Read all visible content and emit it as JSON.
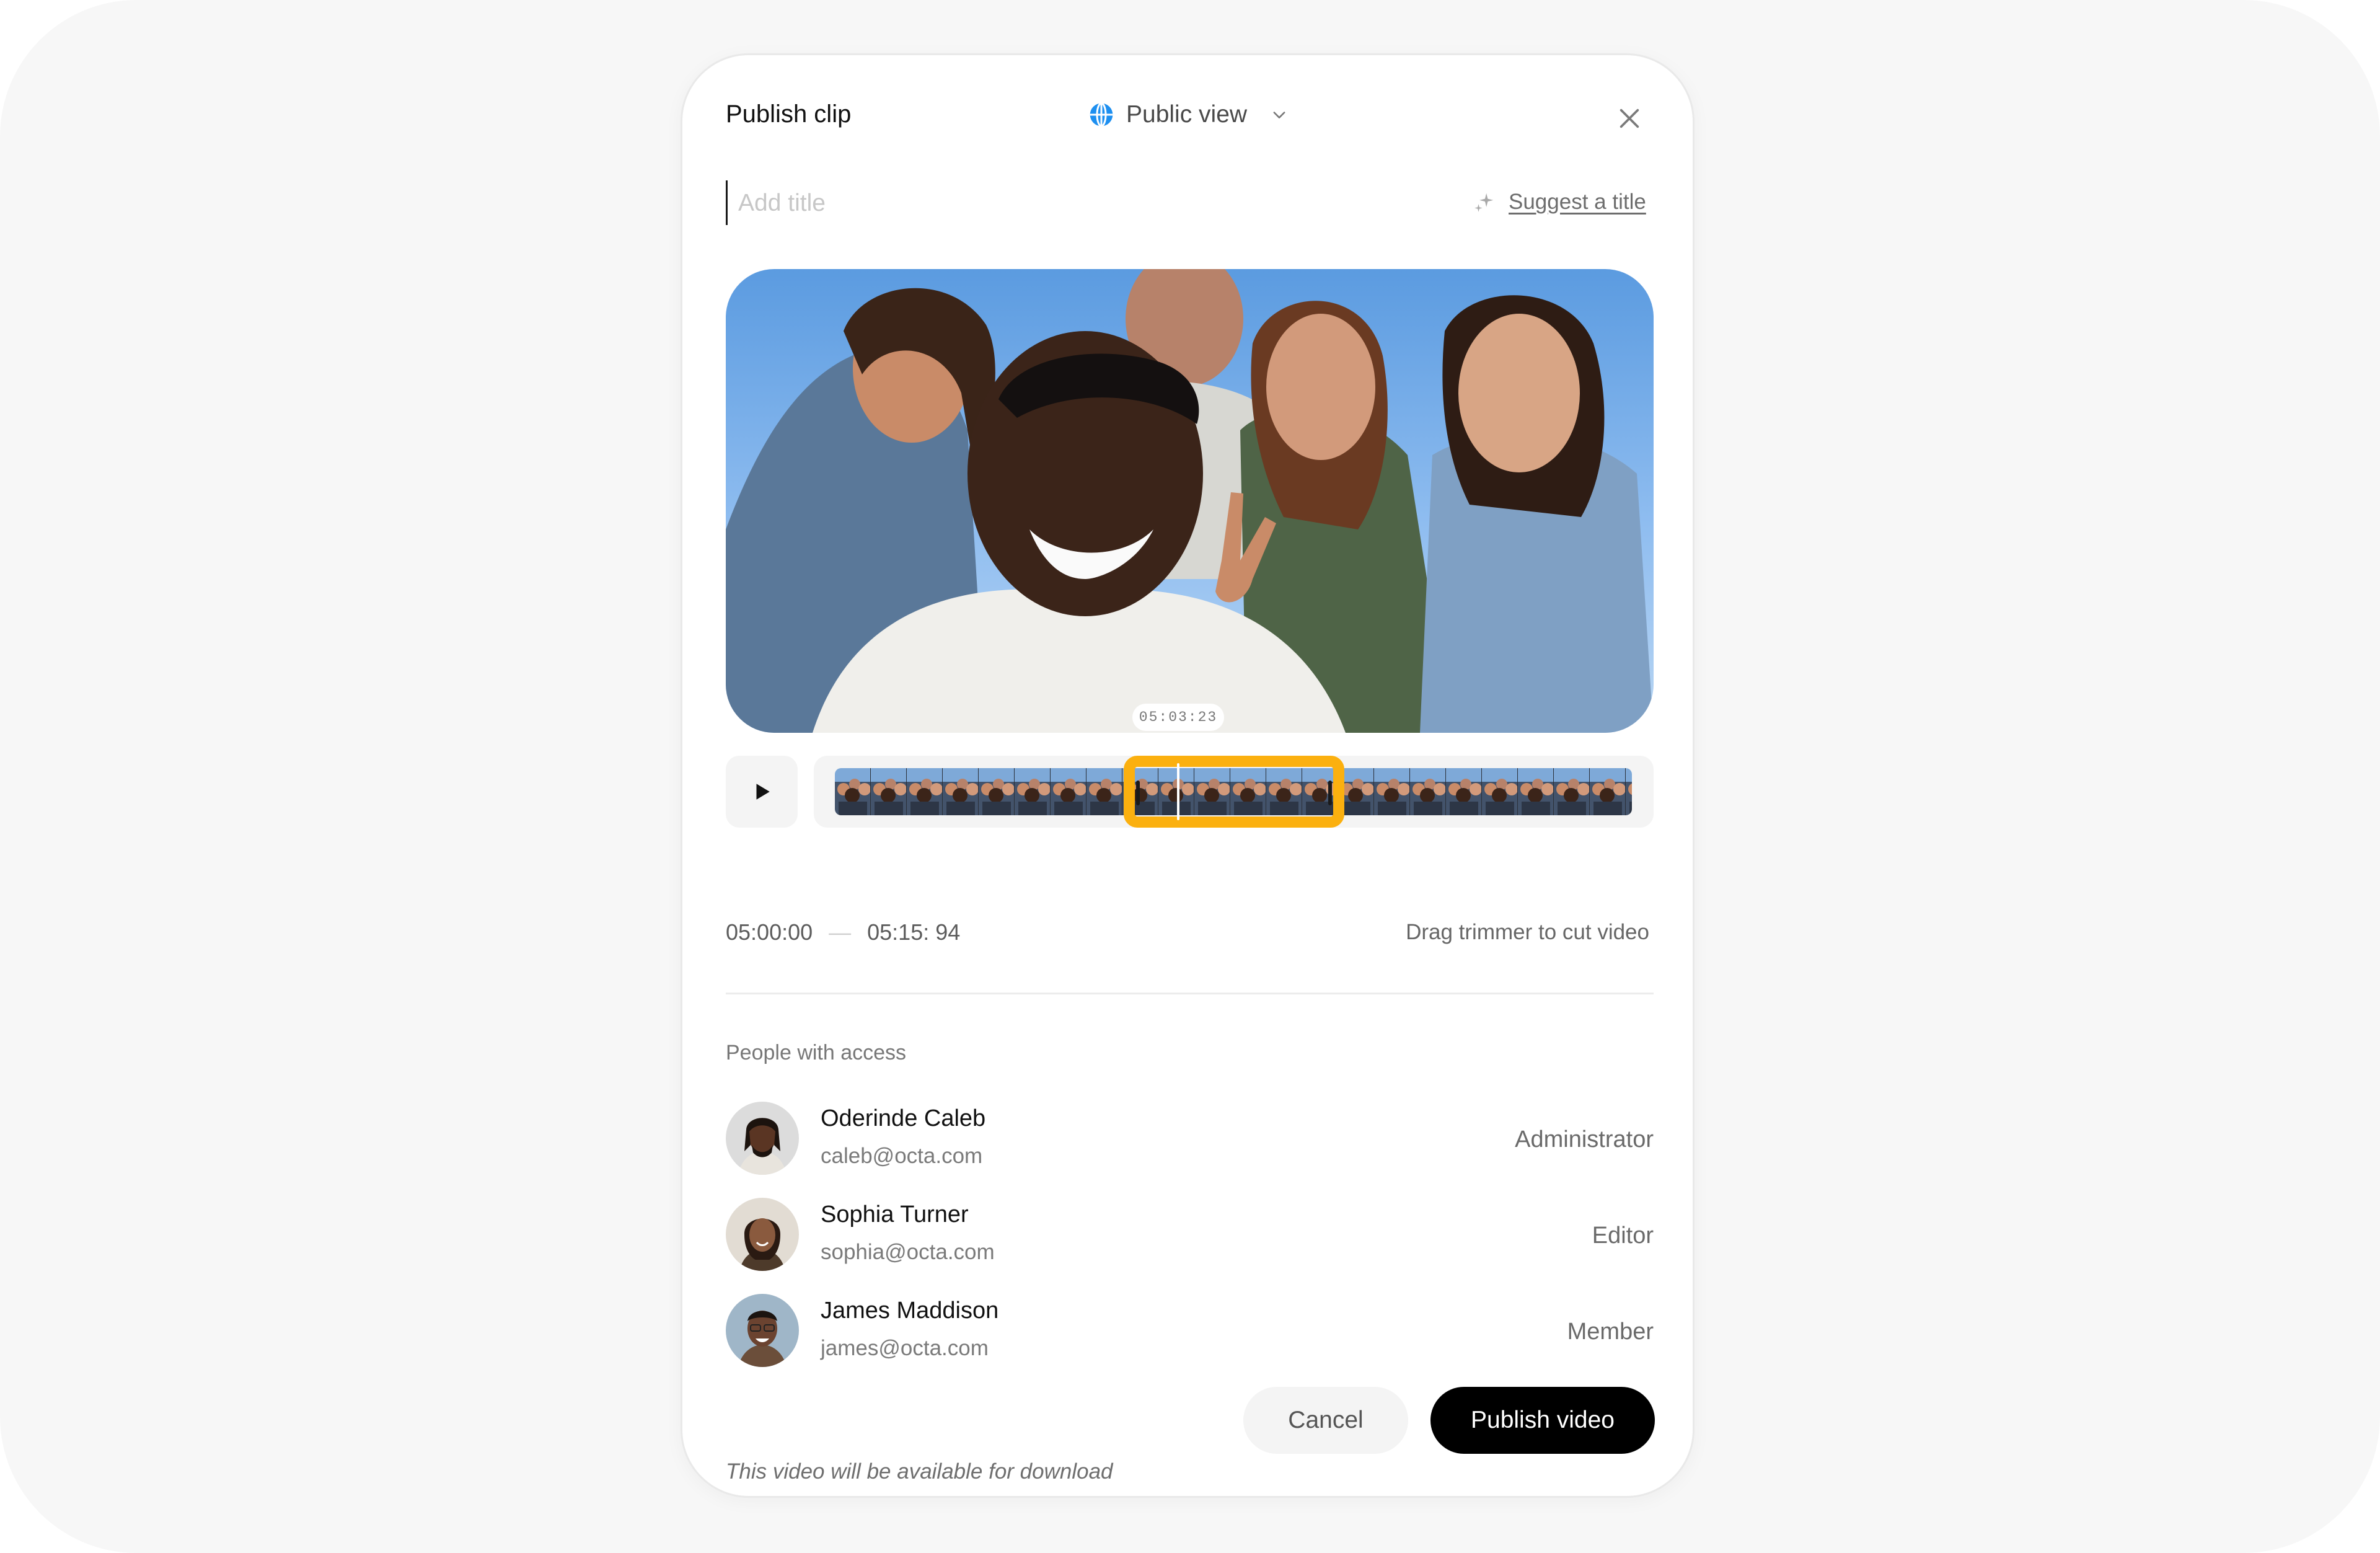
{
  "header": {
    "title": "Publish clip",
    "visibility_label": "Public view"
  },
  "title_field": {
    "value": "",
    "placeholder": "Add title"
  },
  "suggest": {
    "label": "Suggest a title"
  },
  "video": {
    "current_time": "05:03:23"
  },
  "trim": {
    "start": "05:00:00",
    "separator": "—",
    "end": "05:15: 94",
    "hint": "Drag trimmer to cut video"
  },
  "access": {
    "label": "People with access",
    "people": [
      {
        "name": "Oderinde Caleb",
        "email": "caleb@octa.com",
        "role": "Administrator"
      },
      {
        "name": "Sophia Turner",
        "email": "sophia@octa.com",
        "role": "Editor"
      },
      {
        "name": "James Maddison",
        "email": "james@octa.com",
        "role": "Member"
      }
    ]
  },
  "footer": {
    "note": "This video will be available for download",
    "cancel_label": "Cancel",
    "publish_label": "Publish video"
  },
  "colors": {
    "accent_trim": "#fbb00f",
    "globe": "#1d8ff0",
    "primary_button": "#000000"
  },
  "icons": {
    "visibility": "globe-icon",
    "dropdown": "chevron-down-icon",
    "close": "close-icon",
    "suggest": "sparkle-icon",
    "play": "play-icon"
  }
}
